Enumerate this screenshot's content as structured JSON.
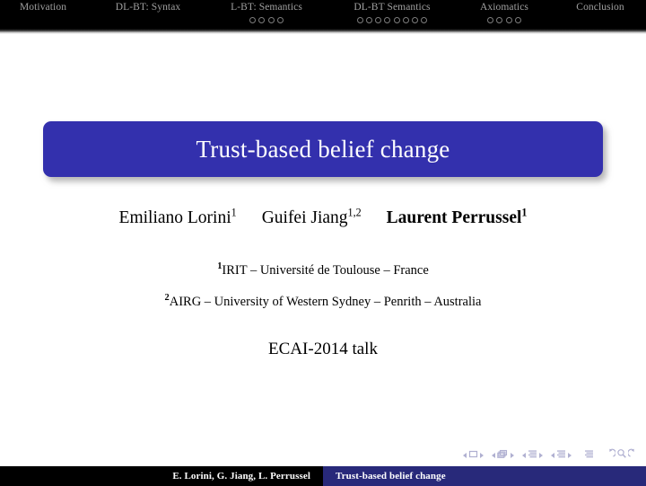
{
  "slide": {
    "background_color": "#ffffff",
    "title": "Trust-based belief change",
    "event": "ECAI-2014 talk"
  },
  "theme": {
    "banner_blue": "#3330AD",
    "footer_blue": "#28297A",
    "header_black": "#000000",
    "nav_label_color": "#A0A0A0",
    "nav_symbol_color": "#3B3B8F"
  },
  "header": {
    "sections": [
      {
        "label": "Motivation",
        "dots": 0
      },
      {
        "label": "DL-BT: Syntax",
        "dots": 0
      },
      {
        "label": "L-BT: Semantics",
        "dots": 4
      },
      {
        "label": "DL-BT Semantics",
        "dots": 8
      },
      {
        "label": "Axiomatics",
        "dots": 4
      },
      {
        "label": "Conclusion",
        "dots": 0
      }
    ]
  },
  "authors": [
    {
      "name": "Emiliano Lorini",
      "marks": "1",
      "bold": false
    },
    {
      "name": "Guifei Jiang",
      "marks": "1,2",
      "bold": false
    },
    {
      "name": "Laurent Perrussel",
      "marks": "1",
      "bold": true
    }
  ],
  "affiliations": [
    {
      "mark": "1",
      "text": "IRIT – Université de Toulouse – France"
    },
    {
      "mark": "2",
      "text": "AIRG – University of Western Sydney – Penrith – Australia"
    }
  ],
  "nav_symbols": [
    "slide-icon",
    "frame-icon",
    "subsection-icon",
    "section-icon",
    "presentation-icon",
    "back-icon",
    "search-icon",
    "forward-icon"
  ],
  "footer": {
    "left_text": "E. Lorini, G. Jiang, L. Perrussel",
    "right_text": "Trust-based belief change"
  }
}
